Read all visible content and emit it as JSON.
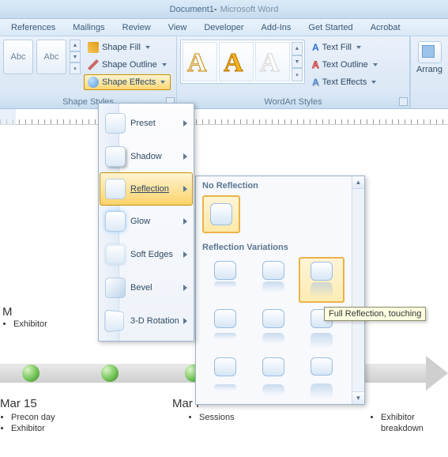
{
  "title": {
    "doc": "Document1",
    "sep": " - ",
    "app": "Microsoft Word"
  },
  "tabs": [
    "References",
    "Mailings",
    "Review",
    "View",
    "Developer",
    "Add-Ins",
    "Get Started",
    "Acrobat"
  ],
  "ribbon": {
    "shape_styles": {
      "label": "Shape Styles",
      "sample": "Abc",
      "fill": "Shape Fill",
      "outline": "Shape Outline",
      "effects": "Shape Effects"
    },
    "wordart": {
      "label": "WordArt Styles",
      "text_fill": "Text Fill",
      "text_outline": "Text Outline",
      "text_effects": "Text Effects",
      "glyph": "A"
    },
    "arrange": {
      "label": "Arrang"
    }
  },
  "effects_menu": {
    "items": [
      {
        "label": "Preset",
        "key": "preset"
      },
      {
        "label": "Shadow",
        "key": "shadow"
      },
      {
        "label": "Reflection",
        "key": "reflection"
      },
      {
        "label": "Glow",
        "key": "glow"
      },
      {
        "label": "Soft Edges",
        "key": "softedges"
      },
      {
        "label": "Bevel",
        "key": "bevel"
      },
      {
        "label": "3-D Rotation",
        "key": "rotation"
      }
    ],
    "selected": "reflection"
  },
  "reflection_panel": {
    "no_reflection_label": "No Reflection",
    "variations_label": "Reflection Variations",
    "hover_tooltip": "Full Reflection, touching"
  },
  "document": {
    "partial_char_1": "M",
    "partial_char_2": "Mar I",
    "dates": {
      "d1": "Mar 15"
    },
    "col1": [
      "Precon day",
      "Exhibitor"
    ],
    "col2": [
      "Sessions"
    ],
    "col3": [
      "Exhibitor",
      "breakdown"
    ],
    "top_bullet": "Exhibitor"
  }
}
